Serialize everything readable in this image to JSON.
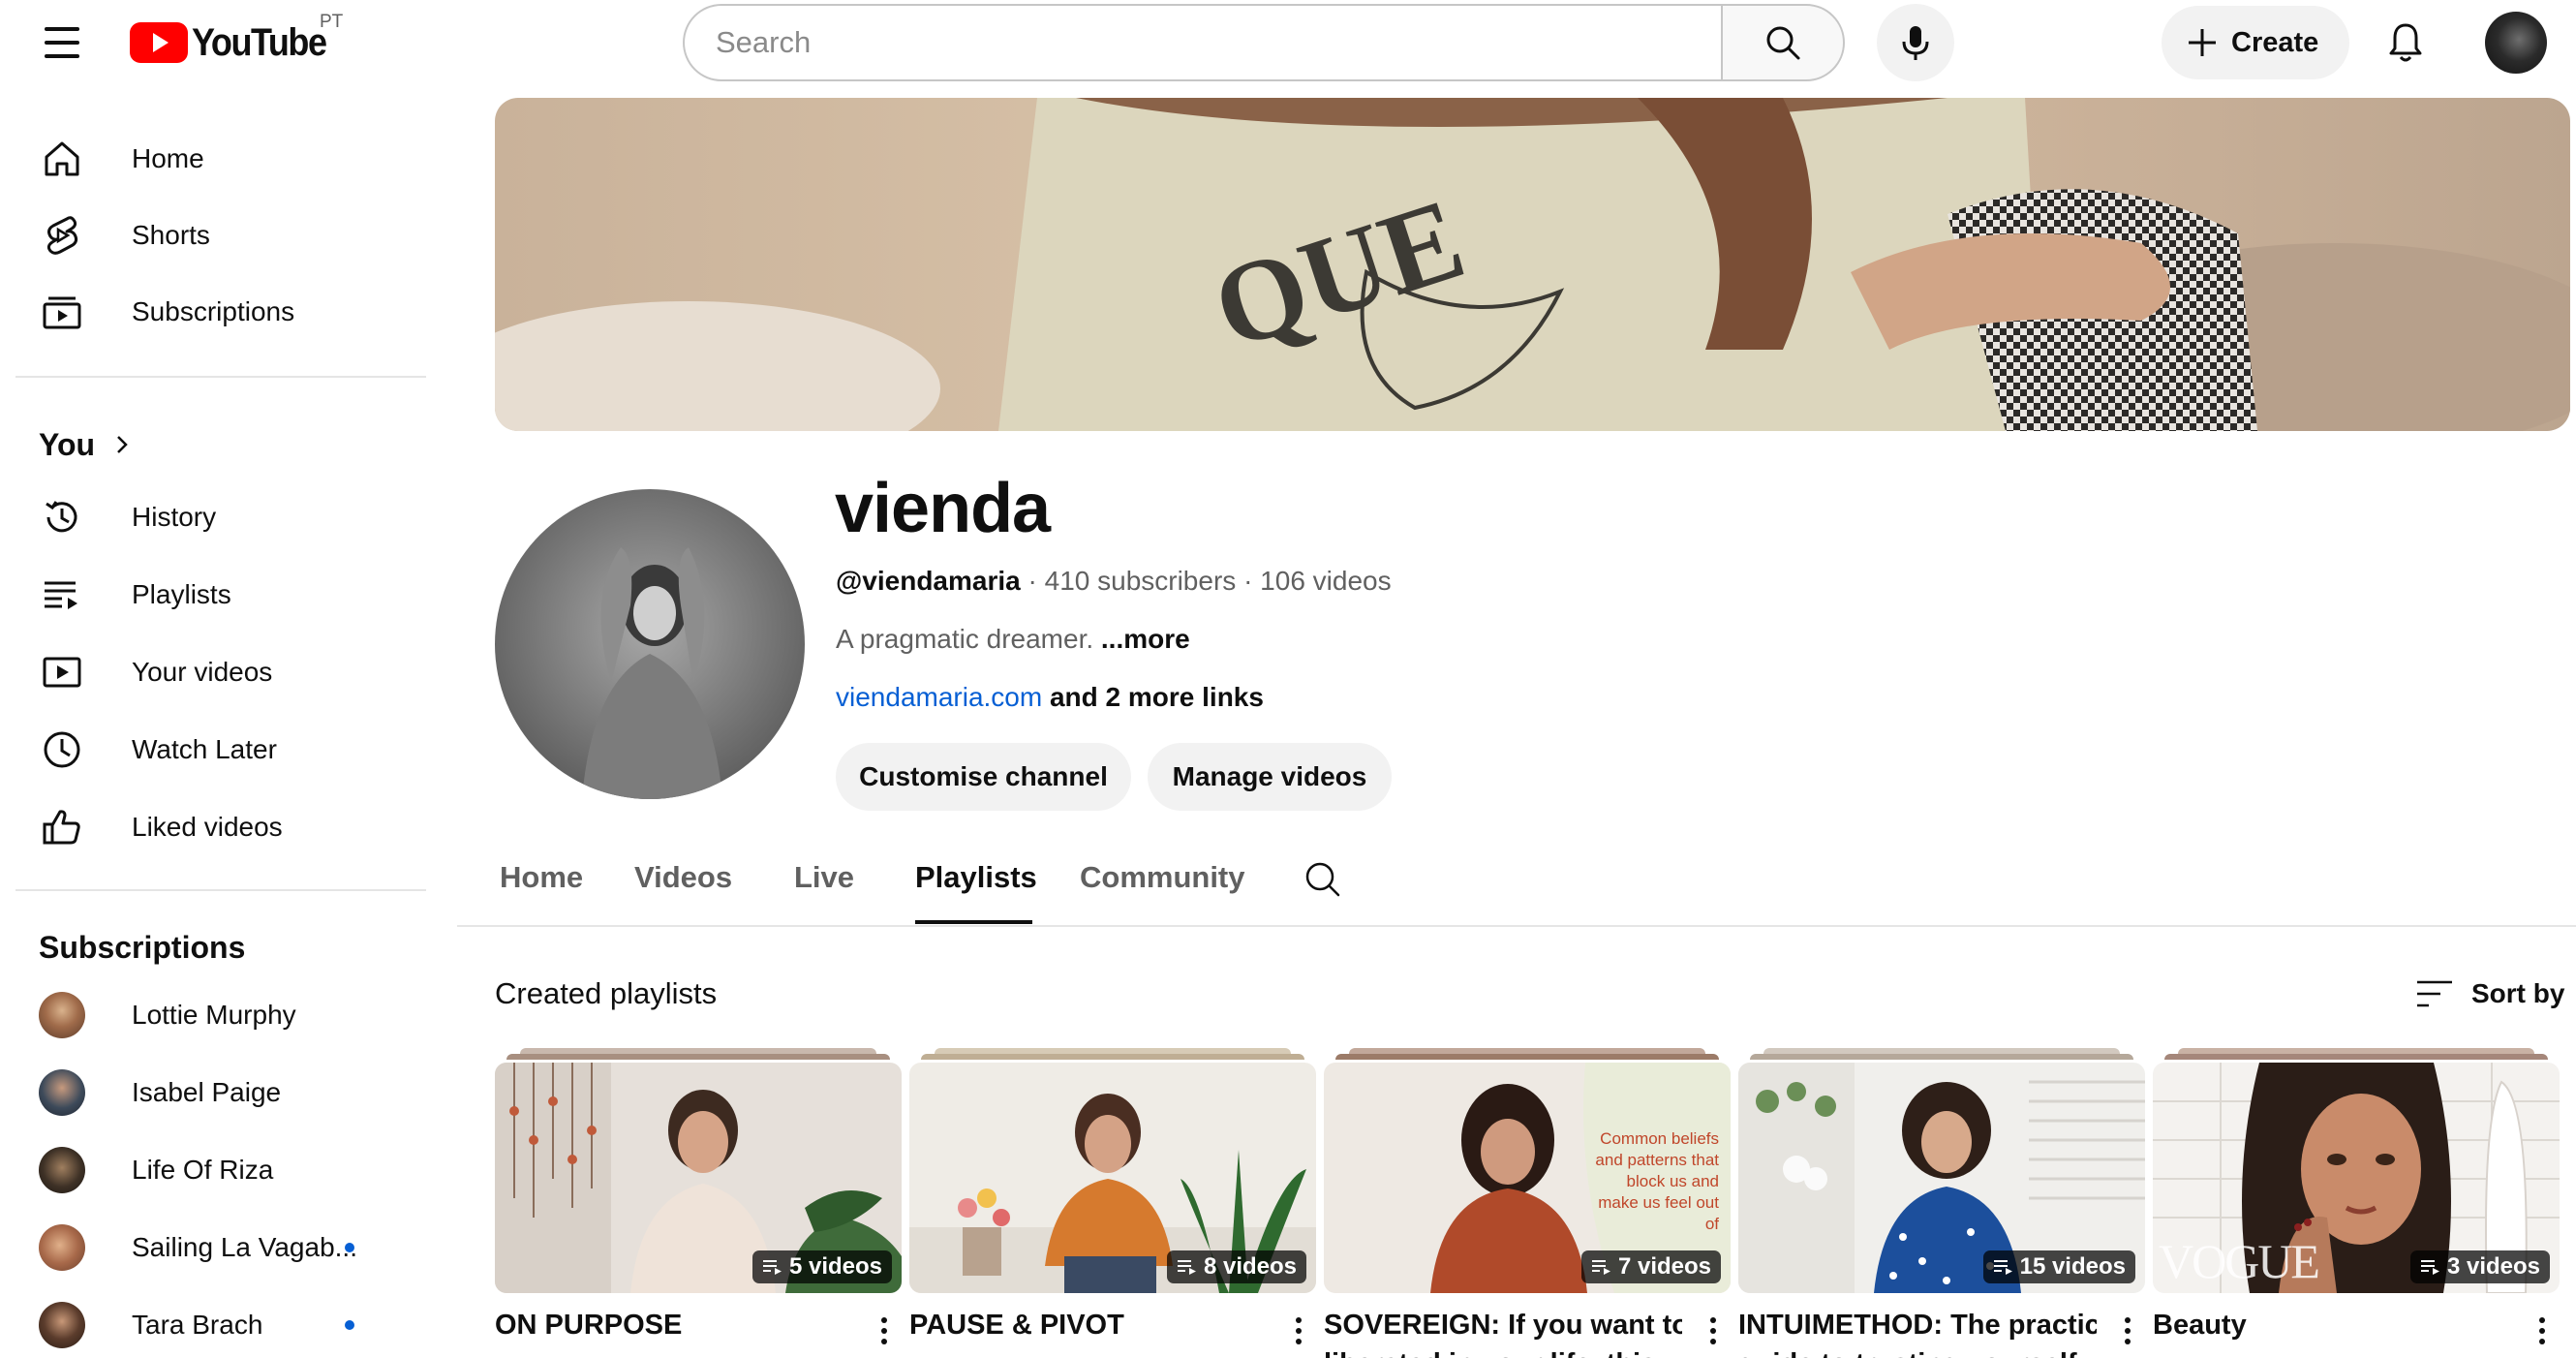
{
  "header": {
    "logo_text": "YouTube",
    "country_code": "PT",
    "search_placeholder": "Search",
    "create_label": "Create"
  },
  "sidebar": {
    "main": [
      {
        "label": "Home",
        "icon": "home-icon"
      },
      {
        "label": "Shorts",
        "icon": "shorts-icon"
      },
      {
        "label": "Subscriptions",
        "icon": "subscriptions-icon"
      }
    ],
    "you_title": "You",
    "you": [
      {
        "label": "History",
        "icon": "history-icon"
      },
      {
        "label": "Playlists",
        "icon": "playlists-icon"
      },
      {
        "label": "Your videos",
        "icon": "your-videos-icon"
      },
      {
        "label": "Watch Later",
        "icon": "watch-later-icon"
      },
      {
        "label": "Liked videos",
        "icon": "liked-videos-icon"
      }
    ],
    "subscriptions_title": "Subscriptions",
    "subscriptions": [
      {
        "label": "Lottie Murphy",
        "new": false
      },
      {
        "label": "Isabel Paige",
        "new": false
      },
      {
        "label": "Life Of Riza",
        "new": false
      },
      {
        "label": "Sailing La Vagab...",
        "new": true
      },
      {
        "label": "Tara Brach",
        "new": true
      }
    ]
  },
  "channel": {
    "name": "vienda",
    "handle": "@viendamaria",
    "subscribers": "410 subscribers",
    "videos": "106 videos",
    "description": "A pragmatic dreamer.",
    "more_label": "...more",
    "link": "viendamaria.com",
    "more_links": "and 2 more links",
    "customise_label": "Customise channel",
    "manage_label": "Manage videos"
  },
  "tabs": [
    "Home",
    "Videos",
    "Live",
    "Playlists",
    "Community"
  ],
  "active_tab": "Playlists",
  "playlists_section": {
    "heading": "Created playlists",
    "sort_label": "Sort by"
  },
  "playlists": [
    {
      "title": "ON PURPOSE",
      "title_line2": "",
      "count": "5 videos"
    },
    {
      "title": "PAUSE & PIVOT",
      "title_line2": "",
      "count": "8 videos"
    },
    {
      "title": "SOVEREIGN: If you want to be",
      "title_line2": "liberated in your life, this",
      "count": "7 videos",
      "thumb_caption": "Common beliefs and patterns that block us and make us feel out of"
    },
    {
      "title": "INTUIMETHOD: The practical",
      "title_line2": "guide to trusting yourself",
      "count": "15 videos"
    },
    {
      "title": "Beauty",
      "title_line2": "",
      "count": "3 videos",
      "thumb_logo": "VOGUE"
    }
  ],
  "colors": {
    "brand_red": "#ff0000",
    "link_blue": "#065fd4",
    "new_dot": "#065fd4"
  }
}
